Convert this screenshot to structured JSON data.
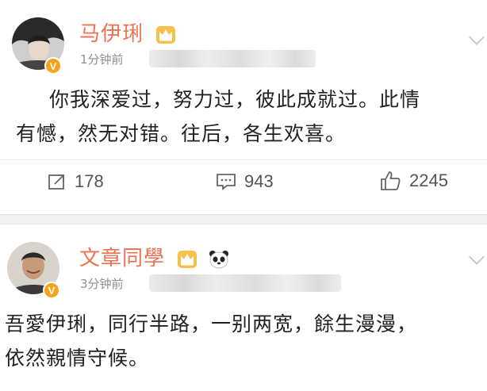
{
  "posts": [
    {
      "author": "马伊琍",
      "time": "1分钟前",
      "content_lines": [
        "你我深爱过，努力过，彼此成就过。此情",
        "有憾，然无对错。往后，各生欢喜。"
      ],
      "actions": {
        "repost_count": "178",
        "comment_count": "943",
        "like_count": "2245"
      },
      "verified_badge": "V",
      "name_color": "#eb7350"
    },
    {
      "author": "文章同學",
      "time": "3分钟前",
      "content_lines": [
        "吾愛伊琍，同行半路，一别两宽，餘生漫漫，",
        "依然親情守候。"
      ],
      "verified_badge": "V",
      "name_color": "#eb7350"
    }
  ],
  "icons": [
    "repost-icon",
    "comment-icon",
    "like-icon",
    "crown-icon",
    "panda-icon",
    "chevron-down-icon",
    "verified-badge-icon"
  ]
}
